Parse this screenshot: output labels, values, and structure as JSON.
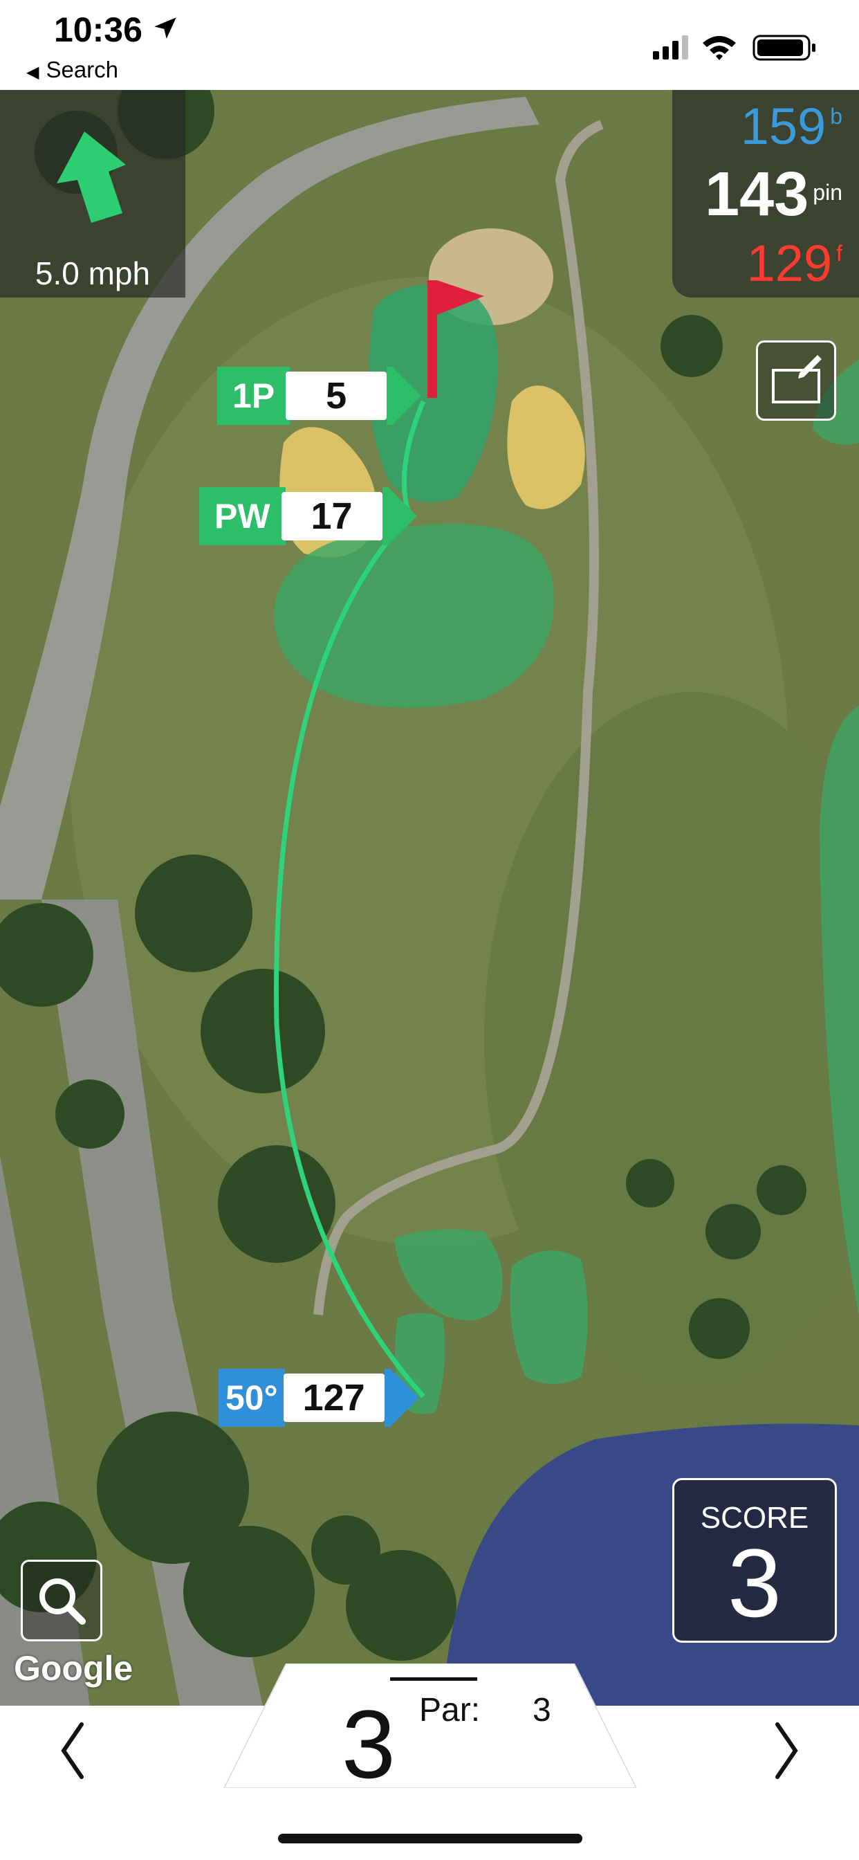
{
  "status_bar": {
    "time": "10:36",
    "back_label": "Search"
  },
  "wind": {
    "speed": "5.0 mph",
    "icon": "wind-direction-arrow-icon"
  },
  "distances": {
    "back": {
      "value": "159",
      "unit": "b"
    },
    "pin": {
      "value": "143",
      "unit": "pin"
    },
    "front": {
      "value": "129",
      "unit": "f"
    }
  },
  "shot_tags": [
    {
      "club": "1P",
      "yards": "5",
      "color": "#2ebd68"
    },
    {
      "club": "PW",
      "yards": "17",
      "color": "#2ebd68"
    },
    {
      "club": "50°",
      "yards": "127",
      "color": "#2f8fd8"
    }
  ],
  "map": {
    "attribution": "Google"
  },
  "score": {
    "label": "SCORE",
    "value": "3"
  },
  "hole": {
    "number": "3",
    "par_label": "Par:",
    "par_value": "3"
  },
  "colors": {
    "shot_line": "#2fd37a",
    "flag": "#e0203a",
    "back_color": "#3a9bdc",
    "front_color": "#ff3b30"
  }
}
